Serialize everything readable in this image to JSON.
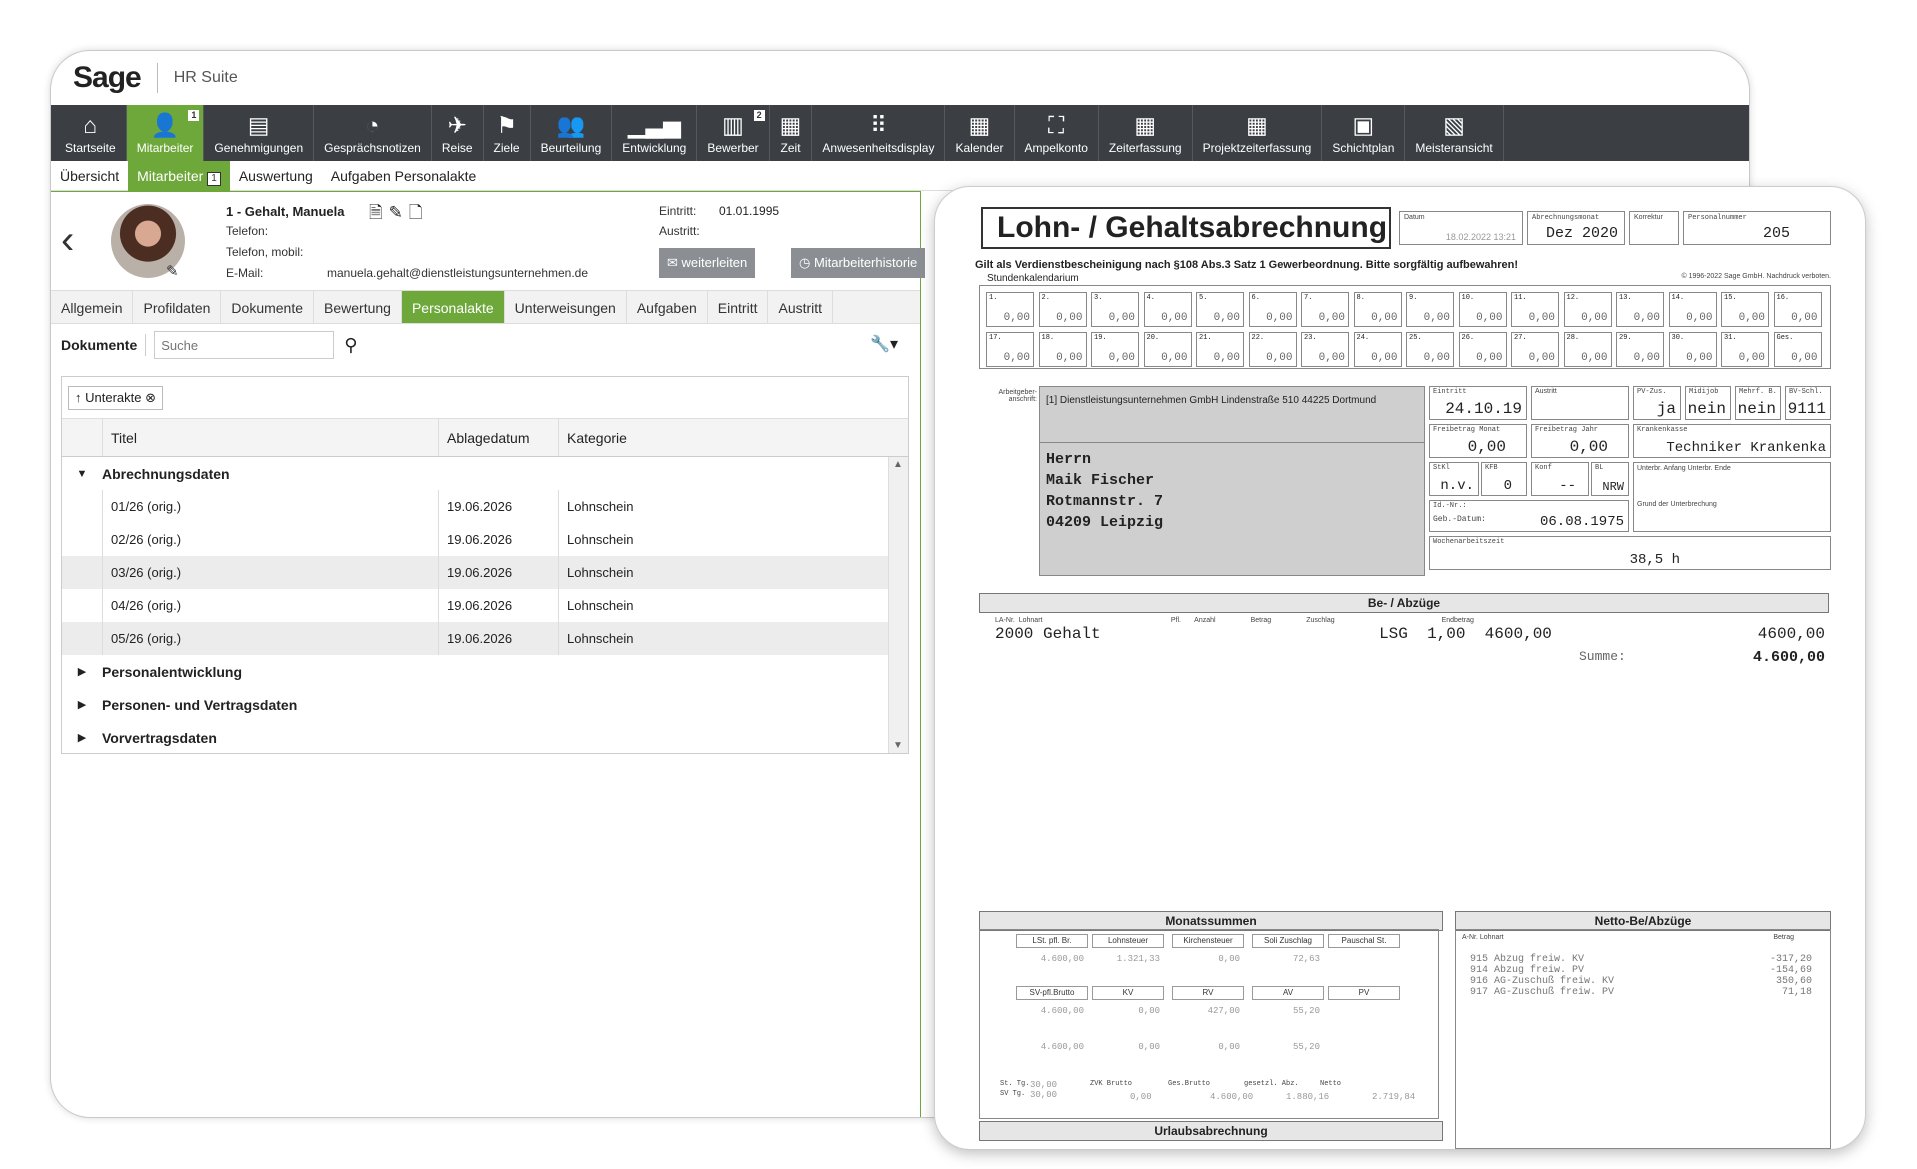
{
  "app": {
    "logo": "Sage",
    "suite": "HR Suite"
  },
  "toolbar": [
    {
      "label": "Startseite",
      "icon": "⌂",
      "icon_name": "home-icon"
    },
    {
      "label": "Mitarbeiter",
      "icon": "👤",
      "icon_name": "employee-icon",
      "badge": "1",
      "active": true
    },
    {
      "label": "Genehmigungen",
      "icon": "▤",
      "icon_name": "approvals-icon"
    },
    {
      "label": "Gesprächsnotizen",
      "icon": "◔",
      "icon_name": "conversation-notes-icon"
    },
    {
      "label": "Reise",
      "icon": "✈",
      "icon_name": "airplane-icon"
    },
    {
      "label": "Ziele",
      "icon": "⚑",
      "icon_name": "goal-flag-icon"
    },
    {
      "label": "Beurteilung",
      "icon": "👥",
      "icon_name": "appraisal-icon"
    },
    {
      "label": "Entwicklung",
      "icon": "▁▃▅",
      "icon_name": "development-chart-icon"
    },
    {
      "label": "Bewerber",
      "icon": "▥",
      "icon_name": "applicants-icon",
      "badge": "2"
    },
    {
      "label": "Zeit",
      "icon": "▦",
      "icon_name": "time-icon"
    },
    {
      "label": "Anwesenheitsdisplay",
      "icon": "⠿",
      "icon_name": "presence-display-icon"
    },
    {
      "label": "Kalender",
      "icon": "▦",
      "icon_name": "calendar-icon"
    },
    {
      "label": "Ampelkonto",
      "icon": "⛶",
      "icon_name": "traffic-light-icon"
    },
    {
      "label": "Zeiterfassung",
      "icon": "▦",
      "icon_name": "time-tracking-icon"
    },
    {
      "label": "Projektzeiterfassung",
      "icon": "▦",
      "icon_name": "project-time-icon"
    },
    {
      "label": "Schichtplan",
      "icon": "▣",
      "icon_name": "shift-plan-icon"
    },
    {
      "label": "Meisteransicht",
      "icon": "▧",
      "icon_name": "foreman-view-icon"
    }
  ],
  "subnav": [
    {
      "label": "Übersicht"
    },
    {
      "label": "Mitarbeiter",
      "badge": "1",
      "active": true
    },
    {
      "label": "Auswertung"
    },
    {
      "label": "Aufgaben Personalakte"
    }
  ],
  "person": {
    "name": "1 - Gehalt, Manuela",
    "phone_label": "Telefon:",
    "mobile_label": "Telefon, mobil:",
    "email_label": "E-Mail:",
    "email": "manuela.gehalt@dienstleistungsunternehmen.de",
    "entry_label": "Eintritt:",
    "entry": "01.01.1995",
    "exit_label": "Austritt:",
    "forward_btn": "weiterleiten",
    "history_btn": "Mitarbeiterhistorie"
  },
  "profile_tabs": [
    "Allgemein",
    "Profildaten",
    "Dokumente",
    "Bewertung",
    "Personalakte",
    "Unterweisungen",
    "Aufgaben",
    "Eintritt",
    "Austritt"
  ],
  "docs": {
    "title": "Dokumente",
    "search_placeholder": "Suche",
    "chip": "↑ Unterakte ⊗",
    "columns": [
      "Titel",
      "Ablagedatum",
      "Kategorie"
    ],
    "groups": {
      "g1": "Abrechnungsdaten",
      "g2": "Personalentwicklung",
      "g3": "Personen- und Vertragsdaten",
      "g4": "Vorvertragsdaten"
    },
    "rows": [
      {
        "title": "01/26 (orig.)",
        "date": "19.06.2026",
        "category": "Lohnschein"
      },
      {
        "title": "02/26 (orig.)",
        "date": "19.06.2026",
        "category": "Lohnschein"
      },
      {
        "title": "03/26 (orig.)",
        "date": "19.06.2026",
        "category": "Lohnschein"
      },
      {
        "title": "04/26 (orig.)",
        "date": "19.06.2026",
        "category": "Lohnschein"
      },
      {
        "title": "05/26 (orig.)",
        "date": "19.06.2026",
        "category": "Lohnschein"
      }
    ]
  },
  "slip": {
    "title": "Lohn- / Gehaltsabrechnung",
    "h_datum_k": "Datum",
    "h_datum_v": "18.02.2022 13:21",
    "h_monat_k": "Abrechnungsmonat",
    "h_monat_v": "Dez 2020",
    "h_korr_k": "Korrektur",
    "h_pnr_k": "Personalnummer",
    "h_pnr_v": "205",
    "notice": "Gilt als Verdienstbescheinigung nach §108 Abs.3 Satz 1 Gewerbeordnung. Bitte sorgfältig aufbewahren!",
    "copyright": "© 1996-2022 Sage GmbH. Nachdruck verboten.",
    "cal_label": "Stundenkalendarium",
    "cal_cells": [
      {
        "n": "1.",
        "v": "0,00"
      },
      {
        "n": "2.",
        "v": "0,00"
      },
      {
        "n": "3.",
        "v": "0,00"
      },
      {
        "n": "4.",
        "v": "0,00"
      },
      {
        "n": "5.",
        "v": "0,00"
      },
      {
        "n": "6.",
        "v": "0,00"
      },
      {
        "n": "7.",
        "v": "0,00"
      },
      {
        "n": "8.",
        "v": "0,00"
      },
      {
        "n": "9.",
        "v": "0,00"
      },
      {
        "n": "10.",
        "v": "0,00"
      },
      {
        "n": "11.",
        "v": "0,00"
      },
      {
        "n": "12.",
        "v": "0,00"
      },
      {
        "n": "13.",
        "v": "0,00"
      },
      {
        "n": "14.",
        "v": "0,00"
      },
      {
        "n": "15.",
        "v": "0,00"
      },
      {
        "n": "16.",
        "v": "0,00"
      },
      {
        "n": "17.",
        "v": "0,00"
      },
      {
        "n": "18.",
        "v": "0,00"
      },
      {
        "n": "19.",
        "v": "0,00"
      },
      {
        "n": "20.",
        "v": "0,00"
      },
      {
        "n": "21.",
        "v": "0,00"
      },
      {
        "n": "22.",
        "v": "0,00"
      },
      {
        "n": "23.",
        "v": "0,00"
      },
      {
        "n": "24.",
        "v": "0,00"
      },
      {
        "n": "25.",
        "v": "0,00"
      },
      {
        "n": "26.",
        "v": "0,00"
      },
      {
        "n": "27.",
        "v": "0,00"
      },
      {
        "n": "28.",
        "v": "0,00"
      },
      {
        "n": "29.",
        "v": "0,00"
      },
      {
        "n": "30.",
        "v": "0,00"
      },
      {
        "n": "31.",
        "v": "0,00"
      },
      {
        "n": "Ges.",
        "v": "0,00"
      }
    ],
    "employer_label": "Arbeitgeber-anschrift:",
    "employer": "[1] Dienstleistungsunternehmen GmbH  Lindenstraße 510 44225 Dortmund",
    "addr": [
      "Herrn",
      "Maik Fischer",
      "Rotmannstr. 7",
      "04209 Leipzig"
    ],
    "f_eintritt_k": "Eintritt",
    "f_eintritt_v": "24.10.19",
    "f_austritt_k": "Austritt",
    "f_pv_k": "PV-Zus.",
    "f_pv_v": "ja",
    "f_midi_k": "Midijob",
    "f_midi_v": "nein",
    "f_mehrf_k": "Mehrf. B.",
    "f_mehrf_v": "nein",
    "f_bv_k": "BV-Schl.",
    "f_bv_v": "9111",
    "f_fbm_k": "Freibetrag Monat",
    "f_fbm_v": "0,00",
    "f_fbj_k": "Freibetrag Jahr",
    "f_fbj_v": "0,00",
    "f_kk_k": "Krankenkasse",
    "f_kk_v": "Techniker Krankenka",
    "f_stkl_k": "StKl",
    "f_stkl_v": "n.v.",
    "f_kfb_k": "KFB",
    "f_kfb_v": "0",
    "f_konf_k": "Konf",
    "f_konf_v": "--",
    "f_bl_k": "BL",
    "f_bl_v": "NRW",
    "f_unt_k": "Unterbr. Anfang       Unterbr. Ende",
    "f_unt2_k": "Grund der Unterbrechung",
    "f_idnr_k": "Id.-Nr.:",
    "f_geb_k": "Geb.-Datum:",
    "f_geb_v": "06.08.1975",
    "f_wz_k": "Wochenarbeitszeit",
    "f_wz_v": "38,5 h",
    "bez_title": "Be- / Abzüge",
    "bez_head": "LA-Nr.  Lohnart                                                                  Pfl.       Anzahl                  Betrag                  Zuschlag                                                       Endbetrag",
    "bez_row": "2000 Gehalt                             LSG  1,00  4600,00",
    "bez_end": "4600,00",
    "sum_label": "Summe:",
    "sum_value": "4.600,00",
    "ms_title": "Monatssummen",
    "netto_title": "Netto-Be/Abzüge",
    "urlaub_title": "Urlaubsabrechnung",
    "ms_h1": [
      "LSt. pfl. Br.",
      "Lohnsteuer",
      "Kirchensteuer",
      "Soli Zuschlag",
      "Pauschal St."
    ],
    "ms_h2": [
      "SV-pfl.Brutto",
      "KV",
      "RV",
      "AV",
      "PV"
    ],
    "ms_v1": [
      "4.600,00",
      "1.321,33",
      "0,00",
      "72,63"
    ],
    "ms_v2": [
      "4.600,00",
      "0,00",
      "427,00",
      "55,20"
    ],
    "ms_v3": [
      "4.600,00",
      "0,00",
      "0,00",
      "55,20"
    ],
    "ms_b": [
      "St. Tg.",
      "SV Tg.",
      "ZVK Brutto",
      "Ges.Brutto",
      "gesetzl. Abz.",
      "Netto"
    ],
    "ms_bv": [
      "30,00",
      "30,00",
      "0,00",
      "4.600,00",
      "1.880,16",
      "2.719,84"
    ],
    "netto_head_a": "A-Nr.  Lohnart",
    "netto_head_b": "Betrag",
    "netto_rows": [
      {
        "l": "915 Abzug freiw. KV",
        "v": "-317,20"
      },
      {
        "l": "914 Abzug freiw. PV",
        "v": "-154,69"
      },
      {
        "l": "916 AG-Zuschuß freiw. KV",
        "v": "350,60"
      },
      {
        "l": "917 AG-Zuschuß freiw. PV",
        "v": "71,18"
      }
    ]
  }
}
